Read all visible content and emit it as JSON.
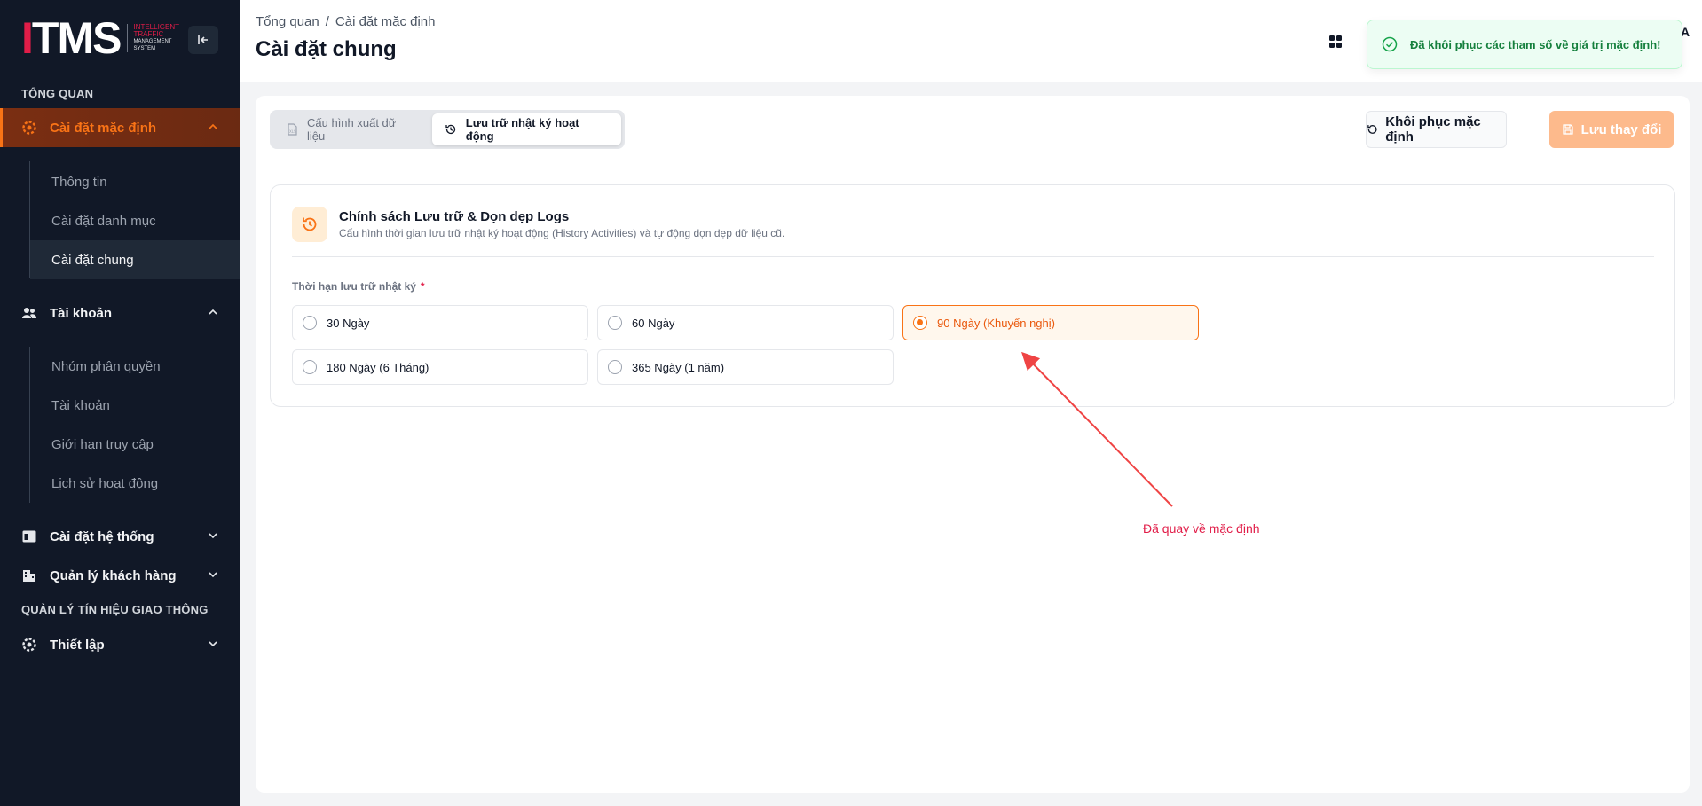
{
  "app": {
    "logo_main": "ITMS",
    "logo_sub": [
      "INTELLIGENT",
      "TRAFFIC",
      "MANAGEMENT",
      "SYSTEM"
    ]
  },
  "sidebar": {
    "section_overview": "TỔNG QUAN",
    "default_settings": "Cài đặt mặc định",
    "default_settings_items": [
      "Thông tin",
      "Cài đặt danh mục",
      "Cài đặt chung"
    ],
    "account": "Tài khoản",
    "account_items": [
      "Nhóm phân quyền",
      "Tài khoản",
      "Giới hạn truy cập",
      "Lịch sử hoạt động"
    ],
    "system_settings": "Cài đặt hệ thống",
    "customer_mgmt": "Quản lý khách hàng",
    "section_traffic": "QUẢN LÝ TÍN HIỆU GIAO THÔNG",
    "setup": "Thiết lập"
  },
  "header": {
    "breadcrumb_root": "Tổng quan",
    "breadcrumb_separator": "/",
    "breadcrumb_current": "Cài đặt mặc định",
    "title": "Cài đặt chung",
    "user_initial": "A"
  },
  "toast": {
    "message": "Đã khôi phục các tham số về giá trị mặc định!"
  },
  "toolbar": {
    "tab_export": "Cấu hình xuất dữ liệu",
    "tab_logs": "Lưu trữ nhật ký hoạt động",
    "reset_label": "Khôi phục mặc định",
    "save_label": "Lưu thay đổi"
  },
  "card": {
    "title": "Chính sách Lưu trữ & Dọn dẹp Logs",
    "description": "Cấu hình thời gian lưu trữ nhật ký hoạt động (History Activities) và tự động dọn dẹp dữ liệu cũ.",
    "field_label": "Thời hạn lưu trữ nhật ký",
    "required_mark": "*",
    "options": [
      "30 Ngày",
      "60 Ngày",
      "90 Ngày (Khuyến nghị)",
      "180 Ngày (6 Tháng)",
      "365 Ngày (1 năm)"
    ],
    "selected_option": "90 Ngày (Khuyến nghị)"
  },
  "annotation": {
    "text": "Đã quay về mặc định"
  },
  "colors": {
    "accent": "#f97316",
    "sidebar_bg": "#111827",
    "success": "#15803d",
    "annotation": "#e11d48"
  }
}
